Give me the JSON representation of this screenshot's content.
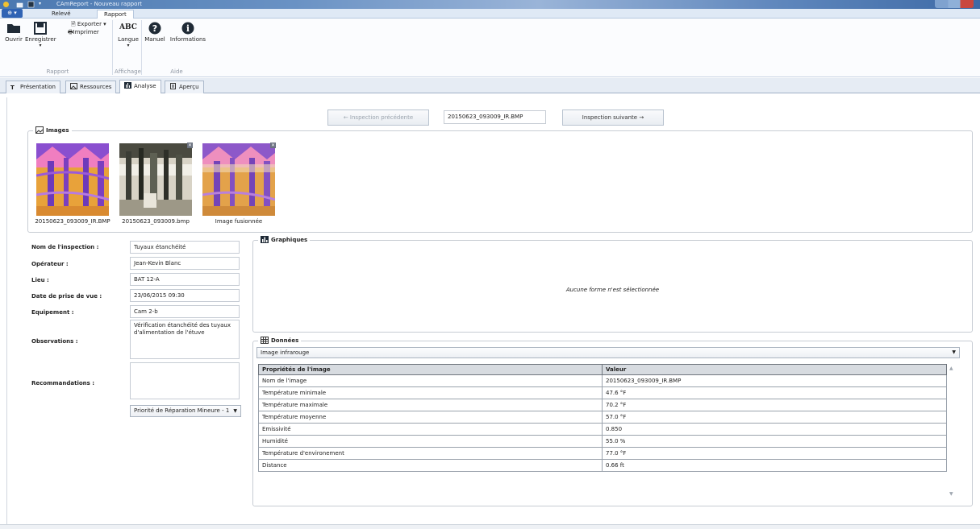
{
  "window": {
    "title": "CAmReport - Nouveau rapport"
  },
  "ribbon": {
    "app_button": "⊕ ▾",
    "tabs": [
      "Relevé",
      "Rapport"
    ],
    "active_tab": "Rapport",
    "buttons": {
      "open": "Ouvrir",
      "save": "Enregistrer",
      "export": "Exporter ▾",
      "print": "Imprimer",
      "language_icon": "ABC",
      "language": "Langue",
      "manual": "Manuel",
      "info": "Informations"
    },
    "groups": {
      "report": "Rapport",
      "display": "Affichage",
      "help": "Aide"
    }
  },
  "doc_tabs": [
    "Présentation",
    "Ressources",
    "Analyse",
    "Aperçu"
  ],
  "active_doc_tab": "Analyse",
  "navigation": {
    "previous": "← Inspection précédente",
    "current_file": "20150623_093009_IR.BMP",
    "next": "Inspection suivante →"
  },
  "images": {
    "title": "Images",
    "items": [
      {
        "caption": "20150623_093009_IR.BMP",
        "kind": "infrared"
      },
      {
        "caption": "20150623_093009.bmp",
        "kind": "visible"
      },
      {
        "caption": "Image fusionnée",
        "kind": "fused"
      }
    ]
  },
  "form": {
    "inspection_name_label": "Nom de l'inspection :",
    "inspection_name": "Tuyaux étanchéité",
    "operator_label": "Opérateur :",
    "operator": "Jean-Kevin Blanc",
    "location_label": "Lieu :",
    "location": "BAT 12-A",
    "date_label": "Date de prise de vue :",
    "date": "23/06/2015 09:30",
    "equipment_label": "Equipement :",
    "equipment": "Cam 2-b",
    "observations_label": "Observations :",
    "observations": "Vérification étanchéité des tuyaux d'alimentation de l'étuve",
    "recommendations_label": "Recommandations :",
    "recommendations": "",
    "priority": "Priorité de Réparation Mineure - 1"
  },
  "charts": {
    "title": "Graphiques",
    "empty_message": "Aucune forme n'est sélectionnée"
  },
  "data_panel": {
    "title": "Données",
    "source_select": "Image infrarouge",
    "columns": [
      "Propriétés de l'image",
      "Valeur"
    ],
    "rows": [
      [
        "Nom de l'image",
        "20150623_093009_IR.BMP"
      ],
      [
        "Température minimale",
        "47.6 °F"
      ],
      [
        "Température maximale",
        "70.2 °F"
      ],
      [
        "Température moyenne",
        "57.0 °F"
      ],
      [
        "Emissivité",
        "0.850"
      ],
      [
        "Humidité",
        "55.0 %"
      ],
      [
        "Température d'environement",
        "77.0 °F"
      ],
      [
        "Distance",
        "0.66 ft"
      ]
    ]
  },
  "colors": {
    "ir_orange": "#e8a23a",
    "ir_purple": "#7b3fbf",
    "accent_blue": "#2f63b4"
  }
}
